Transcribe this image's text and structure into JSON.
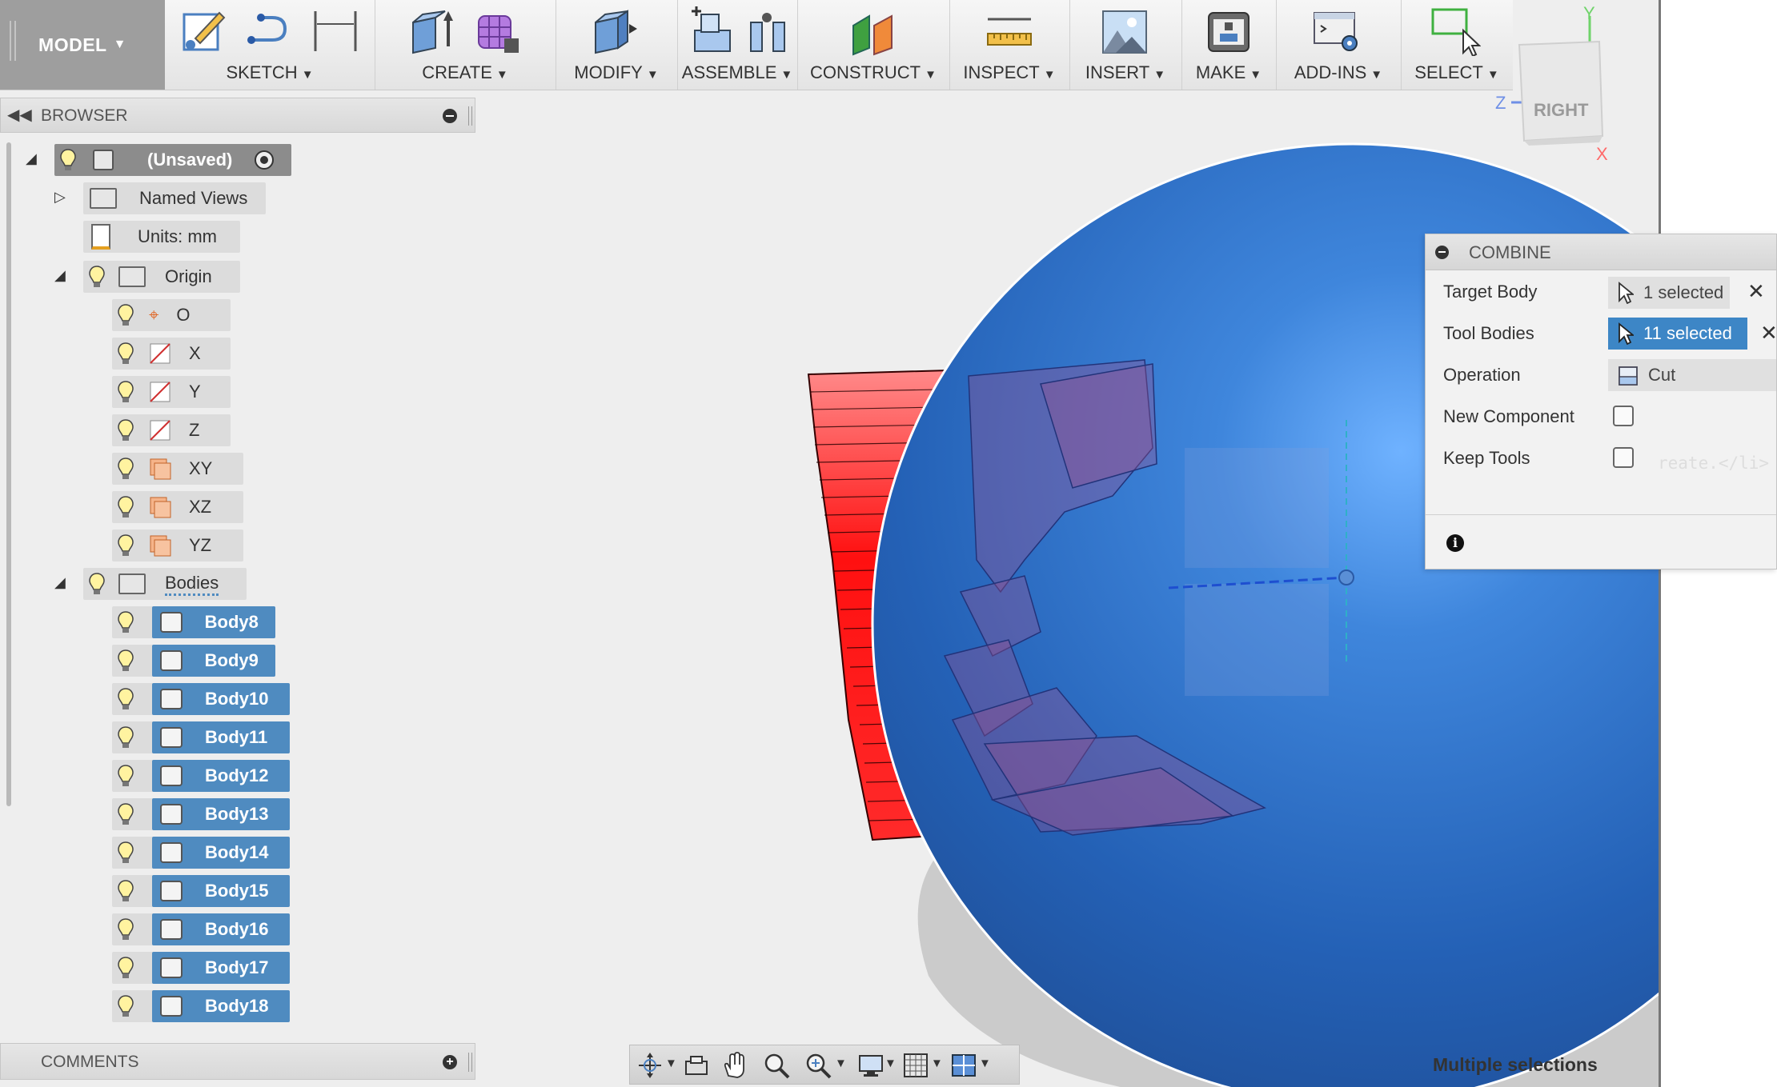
{
  "toolbar": {
    "workspace": "MODEL",
    "groups": [
      {
        "label": "SKETCH"
      },
      {
        "label": "CREATE"
      },
      {
        "label": "MODIFY"
      },
      {
        "label": "ASSEMBLE"
      },
      {
        "label": "CONSTRUCT"
      },
      {
        "label": "INSPECT"
      },
      {
        "label": "INSERT"
      },
      {
        "label": "MAKE"
      },
      {
        "label": "ADD-INS"
      },
      {
        "label": "SELECT"
      }
    ]
  },
  "viewcube": {
    "face": "RIGHT",
    "axis_y": "Y",
    "axis_z": "Z",
    "axis_x": "X"
  },
  "browser": {
    "title": "BROWSER",
    "root": "(Unsaved)",
    "named_views": "Named Views",
    "units": "Units: mm",
    "origin": "Origin",
    "origin_items": [
      "O",
      "X",
      "Y",
      "Z",
      "XY",
      "XZ",
      "YZ"
    ],
    "bodies_folder": "Bodies",
    "bodies": [
      "Body8",
      "Body9",
      "Body10",
      "Body11",
      "Body12",
      "Body13",
      "Body14",
      "Body15",
      "Body16",
      "Body17",
      "Body18"
    ]
  },
  "comments": {
    "title": "COMMENTS"
  },
  "combine": {
    "title": "COMBINE",
    "target_label": "Target Body",
    "target_value": "1 selected",
    "tools_label": "Tool Bodies",
    "tools_value": "11 selected",
    "operation_label": "Operation",
    "operation_value": "Cut",
    "new_component_label": "New Component",
    "new_component_checked": false,
    "keep_tools_label": "Keep Tools",
    "keep_tools_checked": false,
    "ghost_text": "reate.</li>"
  },
  "status": {
    "text": "Multiple selections"
  },
  "colors": {
    "sphere": "#2d6cc0",
    "tool_bodies": "#ff1a1a",
    "selection": "#4f8bc0"
  }
}
